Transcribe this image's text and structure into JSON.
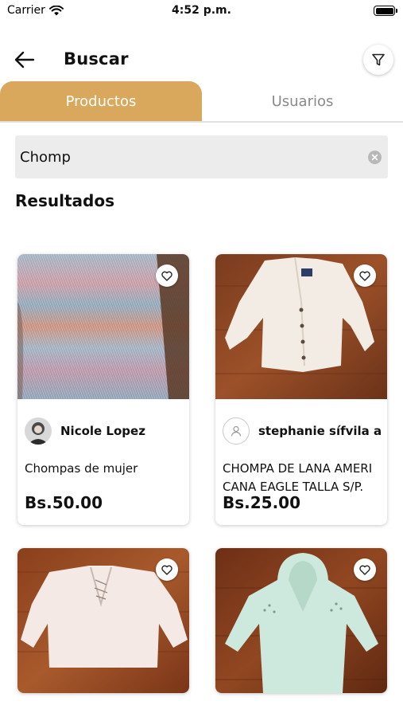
{
  "status_bar": {
    "carrier": "Carrier",
    "time": "4:52 p.m."
  },
  "header": {
    "title": "Buscar",
    "back_icon": "arrow-left-icon",
    "filter_icon": "filter-funnel-icon"
  },
  "tabs": [
    {
      "label": "Productos",
      "active": true
    },
    {
      "label": "Usuarios",
      "active": false
    }
  ],
  "search": {
    "value": "Chomp",
    "placeholder": ""
  },
  "results": {
    "title": "Resultados",
    "items": [
      {
        "seller": "Nicole Lopez",
        "name": "Chompas de mujer",
        "price": "Bs.50.00"
      },
      {
        "seller": "stephanie sífvila a",
        "name": "CHOMPA DE LANA AMERI CANA EAGLE TALLA S/P.",
        "price": "Bs.25.00"
      },
      {
        "seller": "",
        "name": "",
        "price": ""
      },
      {
        "seller": "",
        "name": "",
        "price": ""
      }
    ]
  },
  "colors": {
    "accent": "#d9a85c",
    "inactive_tab_text": "#8a8a8a",
    "search_bg": "#ececec"
  }
}
